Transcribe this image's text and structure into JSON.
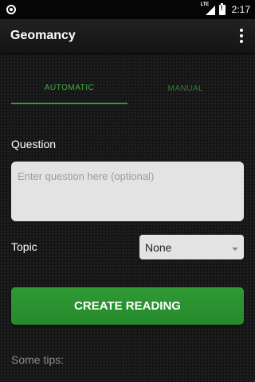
{
  "status_bar": {
    "network_label": "LTE",
    "time": "2:17"
  },
  "app_bar": {
    "title": "Geomancy",
    "menu_icon": "overflow-menu-icon"
  },
  "tabs": [
    {
      "label": "AUTOMATIC",
      "selected": true
    },
    {
      "label": "MANUAL",
      "selected": false
    }
  ],
  "form": {
    "question_label": "Question",
    "question_placeholder": "Enter question here (optional)",
    "question_value": "",
    "topic_label": "Topic",
    "topic_value": "None"
  },
  "create_button_label": "CREATE READING",
  "tips_label": "Some tips:",
  "colors": {
    "accent_green": "#2e9a34",
    "tab_text_green": "#3fb045",
    "background": "#161616",
    "field_background": "#e3e3e3"
  }
}
